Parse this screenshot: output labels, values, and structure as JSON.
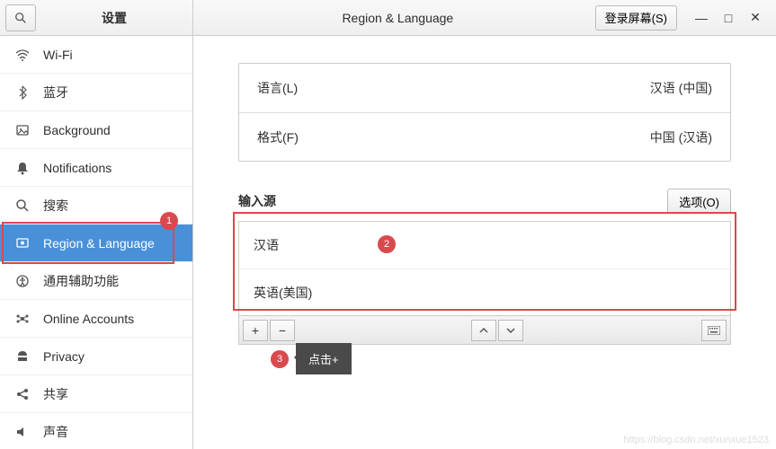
{
  "header": {
    "settings_title": "设置",
    "page_title": "Region & Language",
    "login_screen_btn": "登录屏幕(S)"
  },
  "sidebar": {
    "items": [
      {
        "icon": "wifi",
        "label": "Wi-Fi"
      },
      {
        "icon": "bluetooth",
        "label": "蓝牙"
      },
      {
        "icon": "background",
        "label": "Background"
      },
      {
        "icon": "bell",
        "label": "Notifications"
      },
      {
        "icon": "search",
        "label": "搜索"
      },
      {
        "icon": "region",
        "label": "Region & Language"
      },
      {
        "icon": "accessibility",
        "label": "通用辅助功能"
      },
      {
        "icon": "online",
        "label": "Online Accounts"
      },
      {
        "icon": "privacy",
        "label": "Privacy"
      },
      {
        "icon": "share",
        "label": "共享"
      },
      {
        "icon": "sound",
        "label": "声音"
      }
    ],
    "active_index": 5
  },
  "settings": {
    "language_label": "语言(L)",
    "language_value": "汉语 (中国)",
    "format_label": "格式(F)",
    "format_value": "中国 (汉语)"
  },
  "input_sources": {
    "title": "输入源",
    "options_btn": "选项(O)",
    "items": [
      "汉语",
      "英语(美国)"
    ]
  },
  "annotations": {
    "callout1": "1",
    "callout2": "2",
    "callout3": "3",
    "tooltip": "点击+"
  },
  "watermark": "https://blog.csdn.net/xunxue1523"
}
